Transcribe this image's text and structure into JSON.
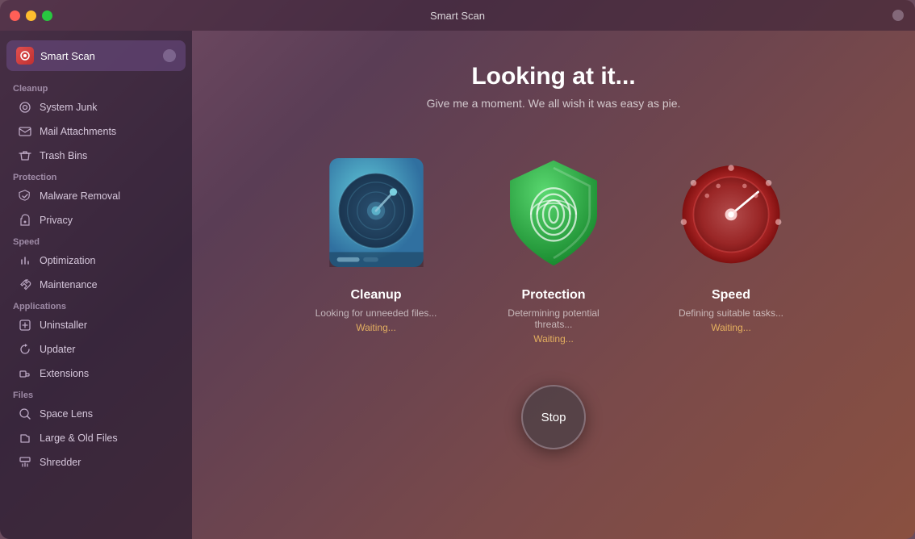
{
  "window": {
    "title": "Smart Scan"
  },
  "sidebar": {
    "smart_scan_label": "Smart Scan",
    "sections": {
      "cleanup": {
        "label": "Cleanup",
        "items": [
          {
            "id": "system-junk",
            "label": "System Junk",
            "icon": "⚙"
          },
          {
            "id": "mail-attachments",
            "label": "Mail Attachments",
            "icon": "✉"
          },
          {
            "id": "trash-bins",
            "label": "Trash Bins",
            "icon": "🗑"
          }
        ]
      },
      "protection": {
        "label": "Protection",
        "items": [
          {
            "id": "malware-removal",
            "label": "Malware Removal",
            "icon": "✳"
          },
          {
            "id": "privacy",
            "label": "Privacy",
            "icon": "✋"
          }
        ]
      },
      "speed": {
        "label": "Speed",
        "items": [
          {
            "id": "optimization",
            "label": "Optimization",
            "icon": "⚡"
          },
          {
            "id": "maintenance",
            "label": "Maintenance",
            "icon": "🔧"
          }
        ]
      },
      "applications": {
        "label": "Applications",
        "items": [
          {
            "id": "uninstaller",
            "label": "Uninstaller",
            "icon": "📦"
          },
          {
            "id": "updater",
            "label": "Updater",
            "icon": "↻"
          },
          {
            "id": "extensions",
            "label": "Extensions",
            "icon": "🔌"
          }
        ]
      },
      "files": {
        "label": "Files",
        "items": [
          {
            "id": "space-lens",
            "label": "Space Lens",
            "icon": "⬤"
          },
          {
            "id": "large-old-files",
            "label": "Large & Old Files",
            "icon": "📁"
          },
          {
            "id": "shredder",
            "label": "Shredder",
            "icon": "📋"
          }
        ]
      }
    }
  },
  "main": {
    "title": "Looking at it...",
    "subtitle": "Give me a moment. We all wish it was easy as pie.",
    "cards": [
      {
        "id": "cleanup",
        "title": "Cleanup",
        "status": "Looking for unneeded files...",
        "waiting": "Waiting..."
      },
      {
        "id": "protection",
        "title": "Protection",
        "status": "Determining potential threats...",
        "waiting": "Waiting..."
      },
      {
        "id": "speed",
        "title": "Speed",
        "status": "Defining suitable tasks...",
        "waiting": "Waiting..."
      }
    ],
    "stop_button_label": "Stop"
  }
}
